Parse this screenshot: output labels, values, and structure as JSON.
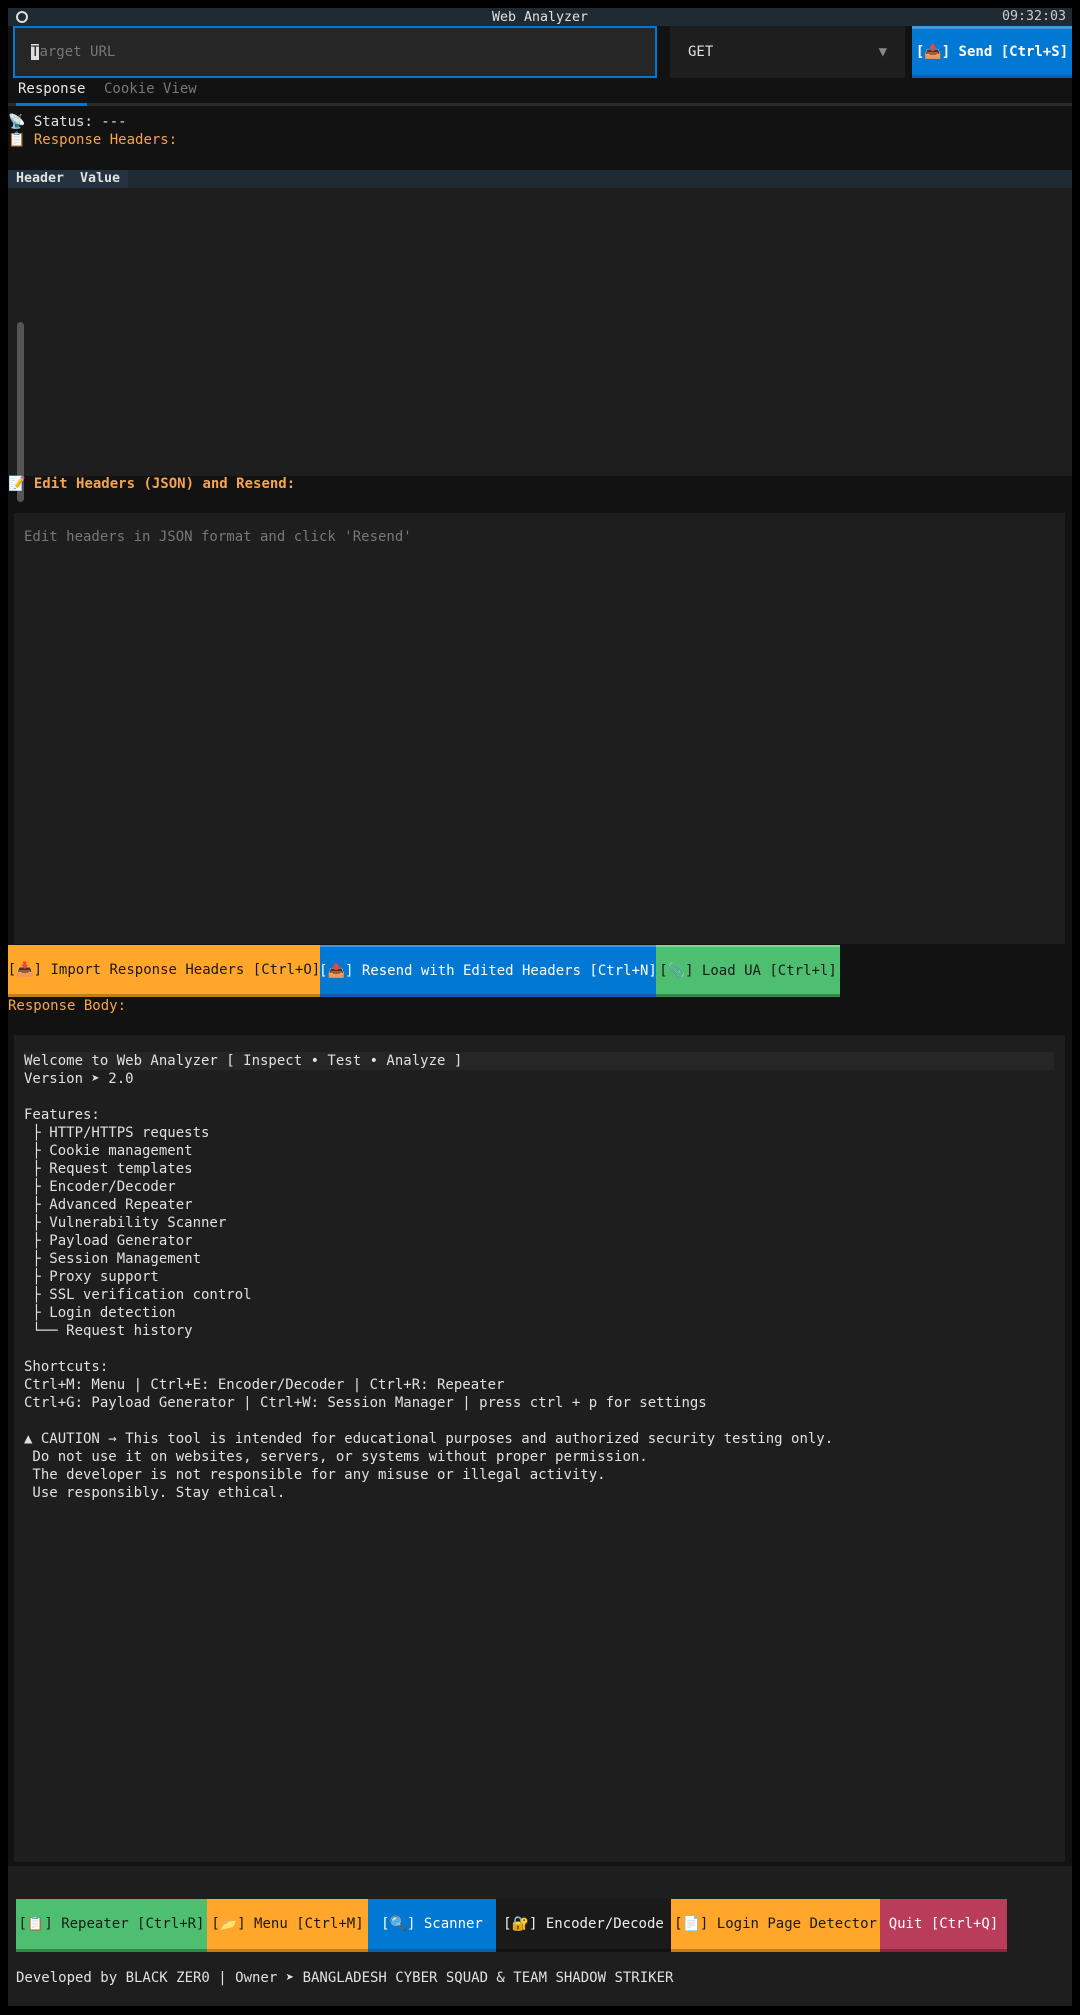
{
  "window": {
    "title": "Web Analyzer",
    "clock": "09:32:03"
  },
  "request": {
    "url_placeholder": "Target URL",
    "url_cursor_char": "T",
    "url_placeholder_rest": "arget URL",
    "method": "GET",
    "send_label": "[📤] Send [Ctrl+S]"
  },
  "tabs": [
    {
      "label": "Response"
    },
    {
      "label": "Cookie View"
    }
  ],
  "response": {
    "status_icon": "📡",
    "status": "Status: ---",
    "headers_icon": "📋",
    "headers_label": "Response Headers:",
    "columns": [
      "Header",
      "Value"
    ]
  },
  "edit": {
    "icon": "📝",
    "label": "Edit Headers (JSON) and Resend:",
    "placeholder": "Edit headers in JSON format and click 'Resend'"
  },
  "actions": [
    {
      "label": "[📥] Import Response Headers [Ctrl+O]"
    },
    {
      "label": "[📤] Resend with Edited Headers [Ctrl+N]"
    },
    {
      "label": "[📎] Load UA [Ctrl+l]"
    }
  ],
  "body": {
    "label": "Response Body:",
    "first_line": "Welcome to Web Analyzer [ Inspect • Test • Analyze ]",
    "rest": "Version ➤ 2.0\n\nFeatures:\n ├ HTTP/HTTPS requests\n ├ Cookie management\n ├ Request templates\n ├ Encoder/Decoder\n ├ Advanced Repeater\n ├ Vulnerability Scanner\n ├ Payload Generator\n ├ Session Management\n ├ Proxy support\n ├ SSL verification control\n ├ Login detection\n └── Request history\n\nShortcuts:\nCtrl+M: Menu | Ctrl+E: Encoder/Decoder | Ctrl+R: Repeater\nCtrl+G: Payload Generator | Ctrl+W: Session Manager | press ctrl + p for settings\n\n▲ CAUTION → This tool is intended for educational purposes and authorized security testing only.\n Do not use it on websites, servers, or systems without proper permission.\n The developer is not responsible for any misuse or illegal activity.\n Use responsibly. Stay ethical."
  },
  "bottom": [
    {
      "label": "[📋] Repeater [Ctrl+R]"
    },
    {
      "label": "[📂] Menu [Ctrl+M]"
    },
    {
      "label": "[🔍] Scanner"
    },
    {
      "label": "[🔐] Encoder/Decode"
    },
    {
      "label": "[📄] Login Page Detector"
    },
    {
      "label": "Quit [Ctrl+Q]"
    }
  ],
  "footer": {
    "credit": "Developed by BLACK ZER0 | Owner ➤ BANGLADESH CYBER SQUAD & TEAM SHADOW STRIKER"
  },
  "colors": {
    "blue": "#0178d4",
    "orange": "#ffa62b",
    "green": "#4ebf71",
    "red": "#ba3c5b"
  }
}
